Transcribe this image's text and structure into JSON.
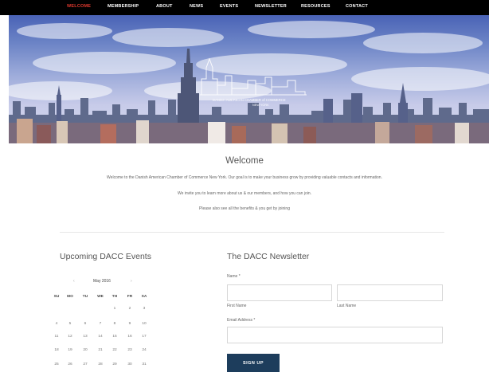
{
  "nav": {
    "items": [
      "WELCOME",
      "MEMBERSHIP",
      "ABOUT",
      "NEWS",
      "EVENTS",
      "NEWSLETTER",
      "RESOURCES",
      "CONTACT"
    ],
    "active_index": 0,
    "active_color": "#e23a2f"
  },
  "hero": {
    "logo_text": "DANISH AMERICAN CHAMBER of COMMERCE",
    "logo_subtext": "NEW YORK"
  },
  "welcome": {
    "title": "Welcome",
    "line1": "Welcome to the Danish American Chamber of Commerce New York. Our goal is to make your business grow by providing valuable contacts and information.",
    "line2": "We invite you to learn more about us & our members, and how you can join.",
    "line3": "Please also see all the benefits & you get by joining"
  },
  "events": {
    "title": "Upcoming DACC Events",
    "calendar": {
      "month": "May 2016",
      "prev": "‹",
      "next": "›",
      "weekdays": [
        "SU",
        "MO",
        "TU",
        "WE",
        "TH",
        "FR",
        "SA"
      ],
      "weeks": [
        [
          "",
          "",
          "",
          "",
          "1",
          "2",
          "3"
        ],
        [
          "4",
          "5",
          "6",
          "7",
          "8",
          "9",
          "10"
        ],
        [
          "11",
          "12",
          "13",
          "14",
          "15",
          "16",
          "17"
        ],
        [
          "18",
          "19",
          "20",
          "21",
          "22",
          "23",
          "24"
        ],
        [
          "25",
          "26",
          "27",
          "28",
          "29",
          "30",
          "31"
        ]
      ]
    }
  },
  "newsletter": {
    "title": "The DACC Newsletter",
    "name_label": "Name *",
    "first_name_label": "First Name",
    "last_name_label": "Last Name",
    "first_name_value": "",
    "last_name_value": "",
    "email_label": "Email Address *",
    "email_value": "",
    "submit_label": "SIGN UP"
  },
  "colors": {
    "nav_bg": "#000000",
    "button_bg": "#1d3d5c"
  }
}
